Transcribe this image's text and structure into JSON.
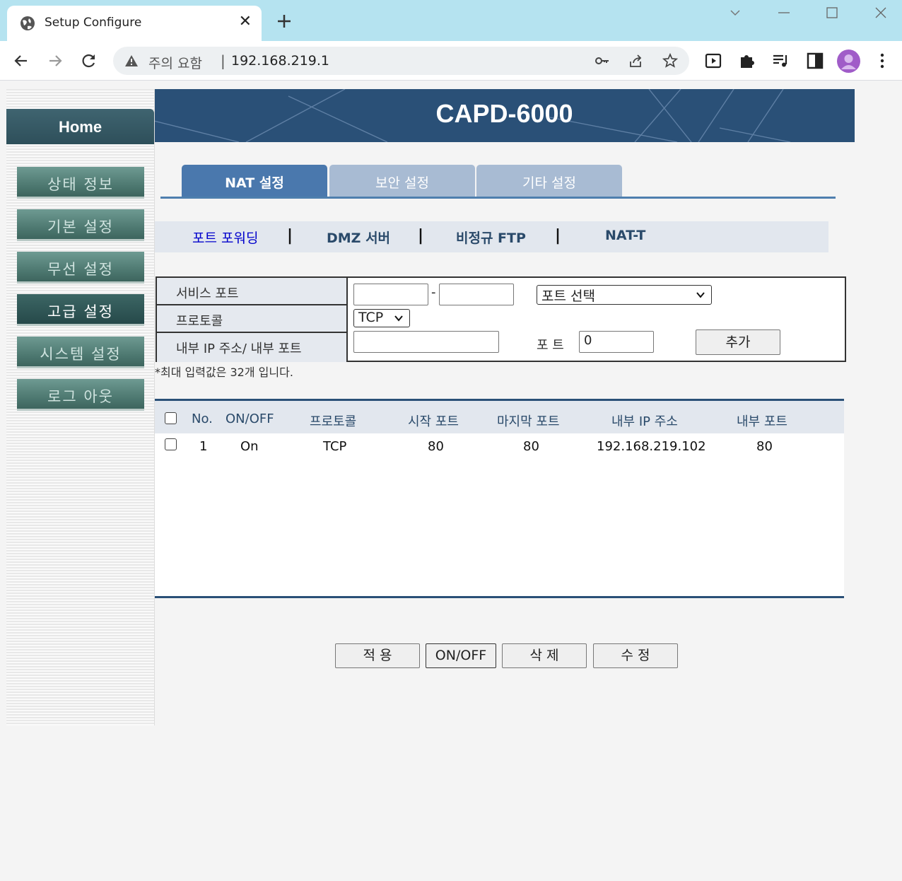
{
  "browser": {
    "tab_title": "Setup Configure",
    "warning_text": "주의 요함",
    "url": "192.168.219.1"
  },
  "page": {
    "banner_title": "CAPD-6000",
    "sidebar": {
      "home": "Home",
      "items": [
        "상태 정보",
        "기본 설정",
        "무선 설정",
        "고급 설정",
        "시스템 설정",
        "로그 아웃"
      ],
      "active_item": "고급 설정"
    },
    "main_tabs": [
      "NAT 설정",
      "보안 설정",
      "기타 설정"
    ],
    "active_main_tab": "NAT 설정",
    "sub_nav": [
      "포트 포워딩",
      "DMZ 서버",
      "비정규 FTP",
      "NAT-T"
    ],
    "active_sub_nav": "포트 포워딩",
    "sub_nav_separator": "|",
    "form": {
      "service_port_label": "서비스 포트",
      "protocol_label": "프로토콜",
      "internal_label": "내부 IP 주소/ 내부 포트",
      "port_dash": "-",
      "port_select_value": "포트 선택",
      "protocol_value": "TCP",
      "port_label": "포 트",
      "port_value": "0",
      "add_button": "추가"
    },
    "note": "*최대 입력값은 32개 입니다.",
    "table": {
      "headers": [
        "No.",
        "ON/OFF",
        "프로토콜",
        "시작 포트",
        "마지막 포트",
        "내부 IP 주소",
        "내부 포트"
      ],
      "rows": [
        [
          "1",
          "On",
          "TCP",
          "80",
          "80",
          "192.168.219.102",
          "80"
        ]
      ]
    },
    "buttons": {
      "apply": "적 용",
      "onoff": "ON/OFF",
      "delete": "삭 제",
      "modify": "수 정"
    }
  }
}
